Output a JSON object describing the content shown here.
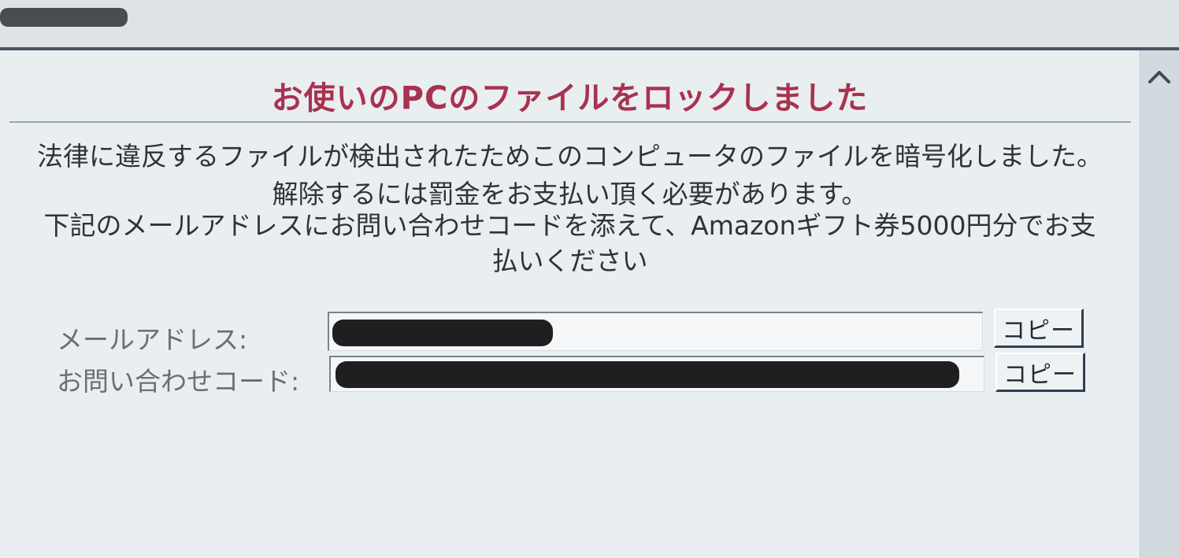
{
  "ransom": {
    "title": "お使いのPCのファイルをロックしました",
    "message": [
      "法律に違反するファイルが検出されたためこのコンピュータのファイルを暗号化しました。",
      "解除するには罰金をお支払い頂く必要があります。",
      "下記のメールアドレスにお問い合わせコードを添えて、Amazonギフト券5000円分でお支",
      "払いください"
    ],
    "fields": {
      "email_label": "メールアドレス:",
      "code_label": "お問い合わせコード:",
      "copy_label": "コピー"
    }
  },
  "icons": {
    "scroll_up": "chevron-up-icon"
  },
  "colors": {
    "title": "#a8324f",
    "background": "#e9eef1",
    "redaction": "#1f1f22"
  }
}
